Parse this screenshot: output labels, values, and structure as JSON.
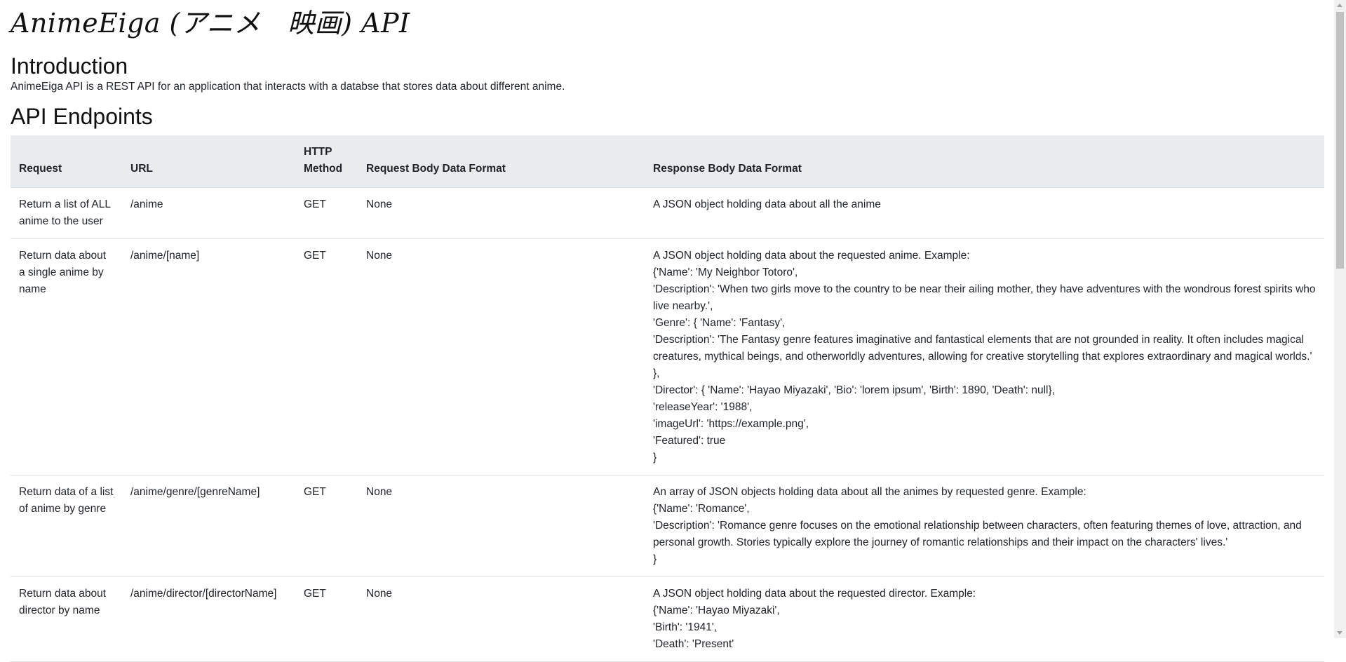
{
  "site_title": "AnimeEiga (アニメ　映画) API",
  "intro": {
    "heading": "Introduction",
    "text": "AnimeEiga API is a REST API for an application that interacts with a databse that stores data about different anime."
  },
  "endpoints": {
    "heading": "API Endpoints",
    "columns": [
      "Request",
      "URL",
      "HTTP Method",
      "Request Body Data Format",
      "Response Body Data Format"
    ],
    "rows": [
      {
        "request": "Return a list of ALL anime to the user",
        "url": "/anime",
        "method": "GET",
        "request_body": "None",
        "response_lines": [
          "A JSON object holding data about all the anime"
        ]
      },
      {
        "request": "Return data about a single anime by name",
        "url": "/anime/[name]",
        "method": "GET",
        "request_body": "None",
        "response_lines": [
          "A JSON object holding data about the requested anime. Example:",
          "{'Name': 'My Neighbor Totoro',",
          "'Description': 'When two girls move to the country to be near their ailing mother, they have adventures with the wondrous forest spirits who live nearby.',",
          "'Genre': { 'Name': 'Fantasy',",
          "'Description': 'The Fantasy genre features imaginative and fantastical elements that are not grounded in reality. It often includes magical creatures, mythical beings, and otherworldly adventures, allowing for creative storytelling that explores extraordinary and magical worlds.' },",
          "'Director': { 'Name': 'Hayao Miyazaki', 'Bio': 'lorem ipsum', 'Birth': 1890, 'Death': null},",
          "'releaseYear': '1988',",
          "'imageUrl': 'https://example.png',",
          "'Featured': true",
          "}"
        ]
      },
      {
        "request": "Return data of a list of anime by genre",
        "url": "/anime/genre/[genreName]",
        "method": "GET",
        "request_body": "None",
        "response_lines": [
          "An array of JSON objects holding data about all the animes by requested genre. Example:",
          "{'Name': 'Romance',",
          "'Description': 'Romance genre focuses on the emotional relationship between characters, often featuring themes of love, attraction, and personal growth. Stories typically explore the journey of romantic relationships and their impact on the characters' lives.'",
          "}"
        ]
      },
      {
        "request": "Return data about director by name",
        "url": "/anime/director/[directorName]",
        "method": "GET",
        "request_body": "None",
        "response_lines": [
          "A JSON object holding data about the requested director. Example:",
          "{'Name': 'Hayao Miyazaki',",
          "'Birth': '1941',",
          "'Death': 'Present'"
        ]
      }
    ]
  }
}
